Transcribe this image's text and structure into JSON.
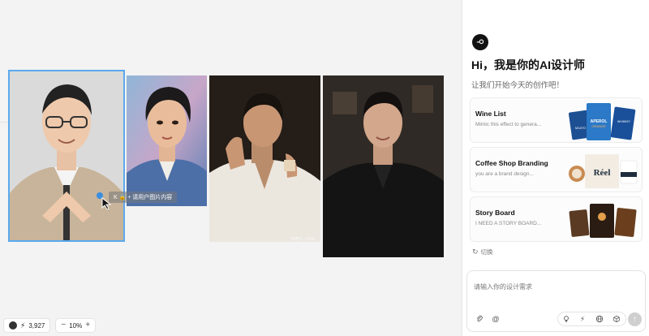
{
  "canvas": {
    "hover_label": "K 🔒 + 请用户图片内容",
    "watermark": "刘德华 / 2018",
    "photos": [
      {
        "name": "photo-man-glasses",
        "bg": "#d9d9d9",
        "selected": true
      },
      {
        "name": "photo-man-denim",
        "bg": "#6f86b2",
        "selected": false
      },
      {
        "name": "photo-man-white-shirt",
        "bg": "#2a221c",
        "selected": false
      },
      {
        "name": "photo-man-black-suit",
        "bg": "#2e2a26",
        "selected": false
      }
    ]
  },
  "bottom_toolbar": {
    "credits": "3,927",
    "zoom": "10%",
    "zoom_out": "−",
    "zoom_in": "+"
  },
  "panel": {
    "greeting": "Hi，我是你的AI设计师",
    "subgreeting": "让我们开始今天的创作吧！",
    "cards": [
      {
        "title": "Wine List",
        "desc": "Mimic this effect to genera..."
      },
      {
        "title": "Coffee Shop Branding",
        "desc": "you are a brand design..."
      },
      {
        "title": "Story Board",
        "desc": "I NEED A STORY BOARD..."
      }
    ],
    "card_art": {
      "wine": [
        "MOJITO",
        "APEROL ORANGE LIGHT",
        "WHISKEY"
      ],
      "coffee": "Réel"
    },
    "switch_label": "切换",
    "input_placeholder": "请输入你的设计需求"
  },
  "colors": {
    "selection": "#5aa9ee",
    "send_disabled": "#cfcfcf"
  }
}
